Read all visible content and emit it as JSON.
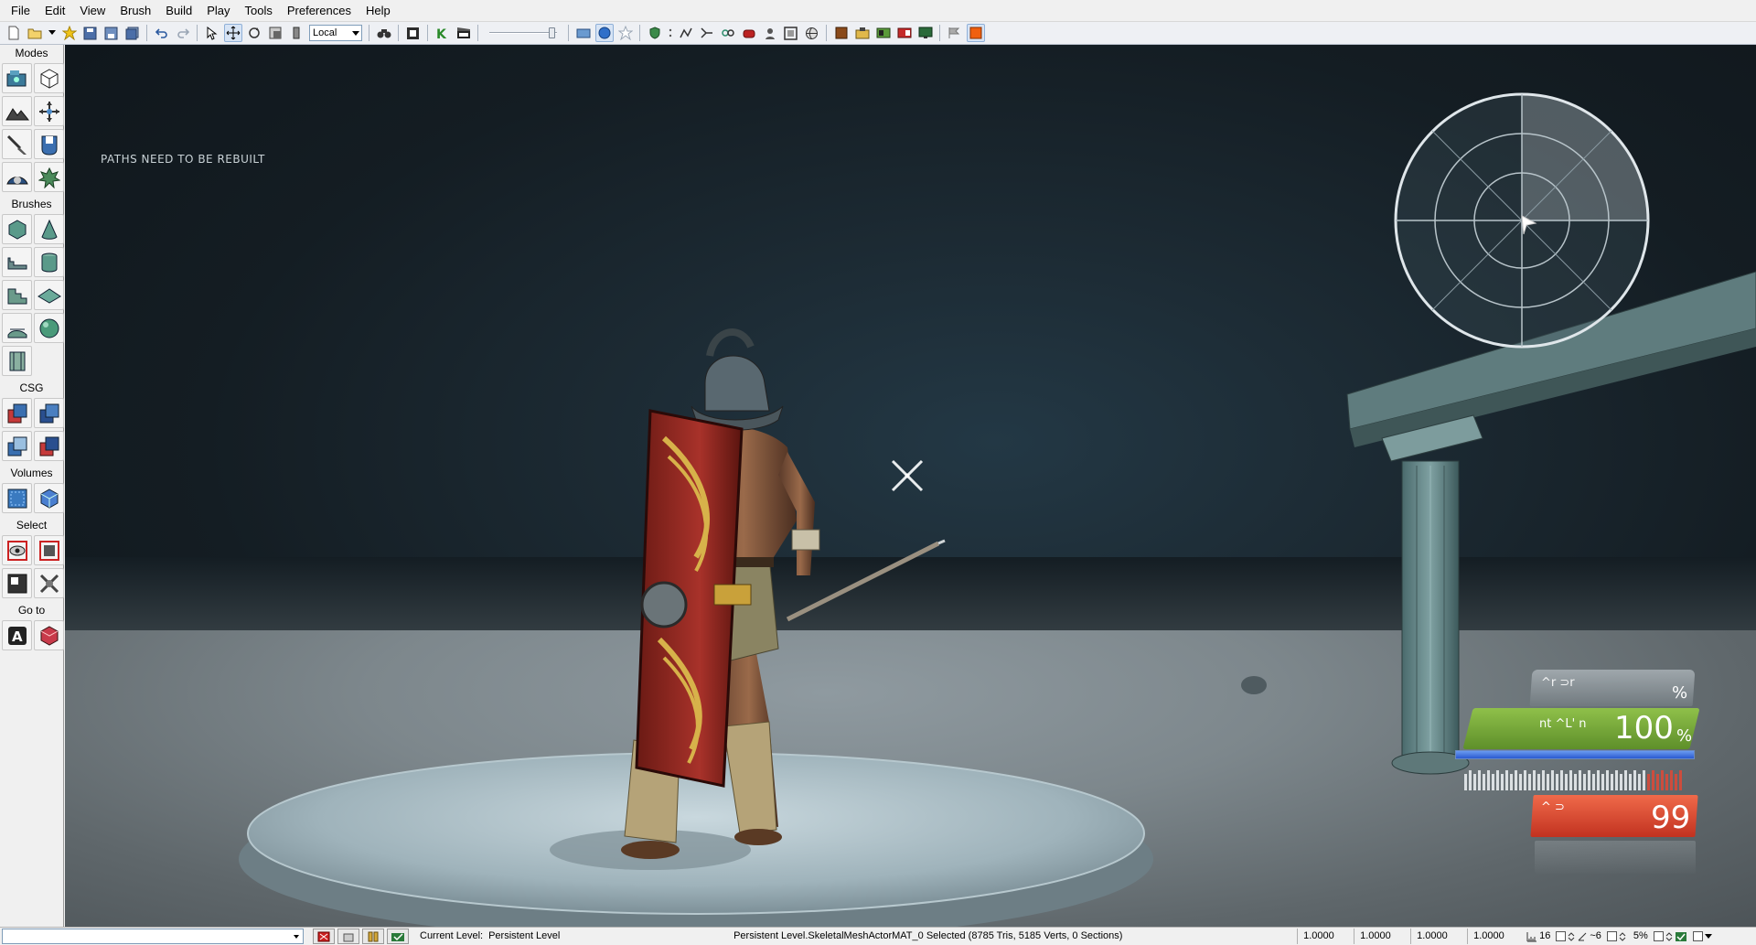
{
  "menu": {
    "items": [
      "File",
      "Edit",
      "View",
      "Brush",
      "Build",
      "Play",
      "Tools",
      "Preferences",
      "Help"
    ]
  },
  "toolbar": {
    "coordinate_system": "Local"
  },
  "left_panel": {
    "sections": {
      "modes": "Modes",
      "brushes": "Brushes",
      "csg": "CSG",
      "volumes": "Volumes",
      "select": "Select",
      "goto": "Go to"
    }
  },
  "viewport": {
    "paths_message": "PATHS NEED TO BE REBUILT"
  },
  "hud": {
    "top_label": "^r  ⊃r",
    "top_unit": "%",
    "health_label": "nt ^L' n",
    "health_value": "100",
    "health_unit": "%",
    "health_fraction": 1.0,
    "ammo_label": "^   ⊃",
    "ammo_value": "99",
    "colors": {
      "health_green": "#6fa330",
      "ammo_red": "#d9412c",
      "shield_blue": "#3a6fe0"
    }
  },
  "statusbar": {
    "current_level_label": "Current Level:",
    "current_level_value": "Persistent Level",
    "selection_info": "Persistent Level.SkeletalMeshActorMAT_0 Selected (8785 Tris, 5185 Verts, 0 Sections)",
    "drag_values": [
      "1.0000",
      "1.0000",
      "1.0000",
      "1.0000"
    ],
    "grid_size": "16",
    "rotation_snap": "~6",
    "scale_snap": "5%"
  }
}
